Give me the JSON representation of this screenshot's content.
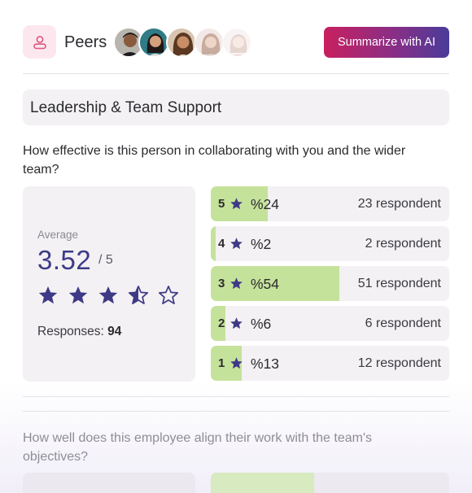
{
  "header": {
    "group_label": "Peers",
    "avatars": [
      {
        "icon": "avatar-person-1"
      },
      {
        "icon": "avatar-person-2"
      },
      {
        "icon": "avatar-person-3"
      },
      {
        "icon": "avatar-person-4"
      },
      {
        "icon": "avatar-person-5"
      }
    ],
    "summarize_label": "Summarize with AI"
  },
  "section": {
    "title": "Leadership & Team Support"
  },
  "question_1": {
    "text": "How effective is this person in collaborating with you and the wider team?",
    "average_label": "Average",
    "average_value": "3.52",
    "average_max": "/ 5",
    "star_rating": 3.5,
    "responses_label": "Responses: ",
    "responses_count": "94",
    "ratings": [
      {
        "stars": "5",
        "percent_label": "%24",
        "fill_percent": 24,
        "count_label": "23 respondent"
      },
      {
        "stars": "4",
        "percent_label": "%2",
        "fill_percent": 2,
        "count_label": "2 respondent"
      },
      {
        "stars": "3",
        "percent_label": "%54",
        "fill_percent": 54,
        "count_label": "51 respondent"
      },
      {
        "stars": "2",
        "percent_label": "%6",
        "fill_percent": 6,
        "count_label": "6 respondent"
      },
      {
        "stars": "1",
        "percent_label": "%13",
        "fill_percent": 13,
        "count_label": "12 respondent"
      }
    ]
  },
  "question_2": {
    "text": "How well does this employee align their work with the team's objectives?"
  },
  "colors": {
    "accent": "#3e3a86",
    "bar_fill": "#c5e29b",
    "card_bg": "#f3f1f3",
    "button_gradient_start": "#c8205f",
    "button_gradient_end": "#4a3c9a"
  }
}
